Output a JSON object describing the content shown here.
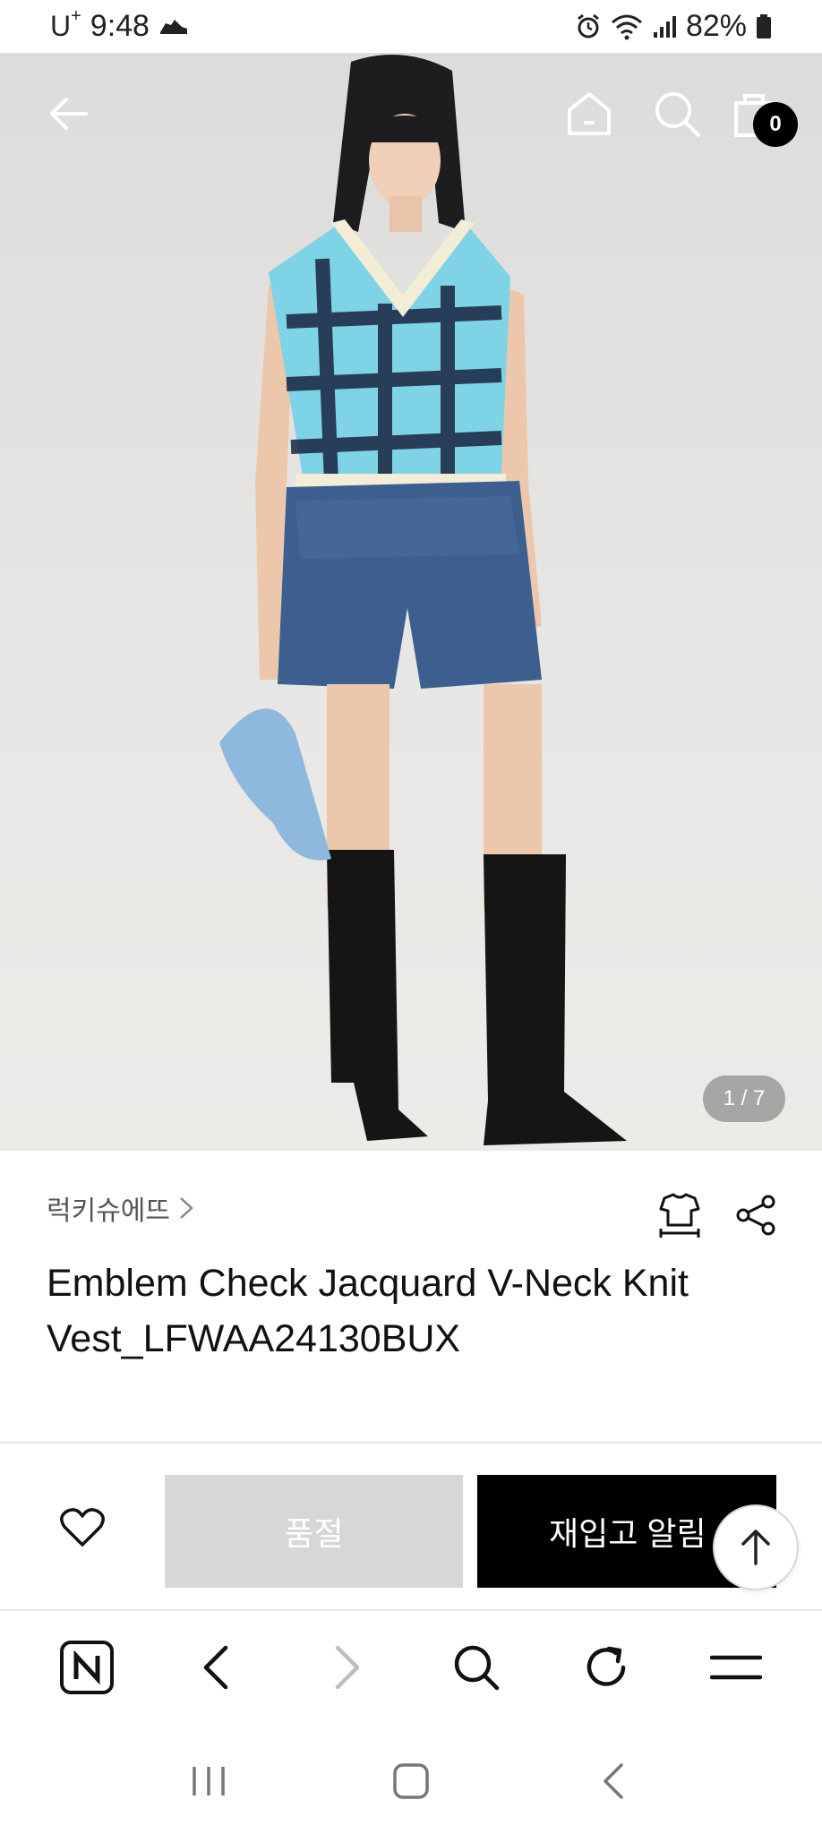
{
  "status_bar": {
    "carrier": "U",
    "carrier_sup": "+",
    "time": "9:48",
    "battery": "82%"
  },
  "hero": {
    "cart_count": "0",
    "page_indicator": "1 / 7"
  },
  "product": {
    "brand": "럭키슈에뜨",
    "title": "Emblem Check Jacquard V-Neck Knit Vest_LFWAA24130BUX"
  },
  "actions": {
    "soldout_label": "품절",
    "restock_label": "재입고 알림"
  },
  "colors": {
    "accent": "#000000",
    "soldout_bg": "#d7d7d7"
  },
  "icons": {
    "back": "arrow-left-icon",
    "home": "home-icon",
    "search": "search-icon",
    "cart": "shopping-bag-icon",
    "size": "size-guide-icon",
    "share": "share-icon",
    "wish": "heart-icon",
    "top": "arrow-up-icon"
  }
}
